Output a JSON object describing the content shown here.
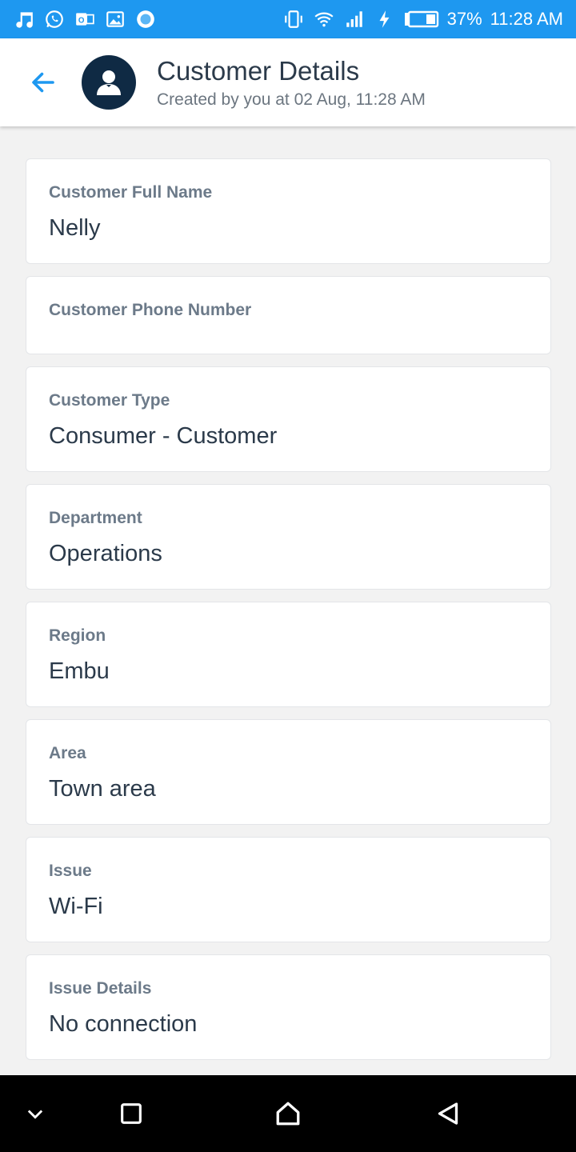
{
  "status_bar": {
    "battery_percent": "37%",
    "time": "11:28 AM",
    "left_icons": [
      "music-icon",
      "whatsapp-icon",
      "outlook-icon",
      "gallery-icon",
      "circle-app-icon"
    ],
    "right_icons": [
      "vibrate-icon",
      "wifi-icon",
      "signal-icon",
      "charging-icon",
      "battery-icon"
    ]
  },
  "header": {
    "title": "Customer Details",
    "subtitle": "Created by you at 02 Aug, 11:28 AM"
  },
  "fields": [
    {
      "label": "Customer Full Name",
      "value": "Nelly"
    },
    {
      "label": "Customer Phone Number",
      "value": ""
    },
    {
      "label": "Customer Type",
      "value": "Consumer - Customer"
    },
    {
      "label": "Department",
      "value": "Operations"
    },
    {
      "label": "Region",
      "value": "Embu"
    },
    {
      "label": "Area",
      "value": "Town area"
    },
    {
      "label": "Issue",
      "value": "Wi-Fi"
    },
    {
      "label": "Issue Details",
      "value": "No connection"
    }
  ],
  "colors": {
    "status_bar": "#1e98f0",
    "accent": "#1e98f0",
    "avatar_bg": "#0f2a44",
    "title_text": "#2b3a4a",
    "label_text": "#6c7a89",
    "background": "#f2f2f2"
  },
  "nav_bar": {
    "icons": [
      "chevron-down-icon",
      "recents-icon",
      "home-icon",
      "back-triangle-icon"
    ]
  }
}
